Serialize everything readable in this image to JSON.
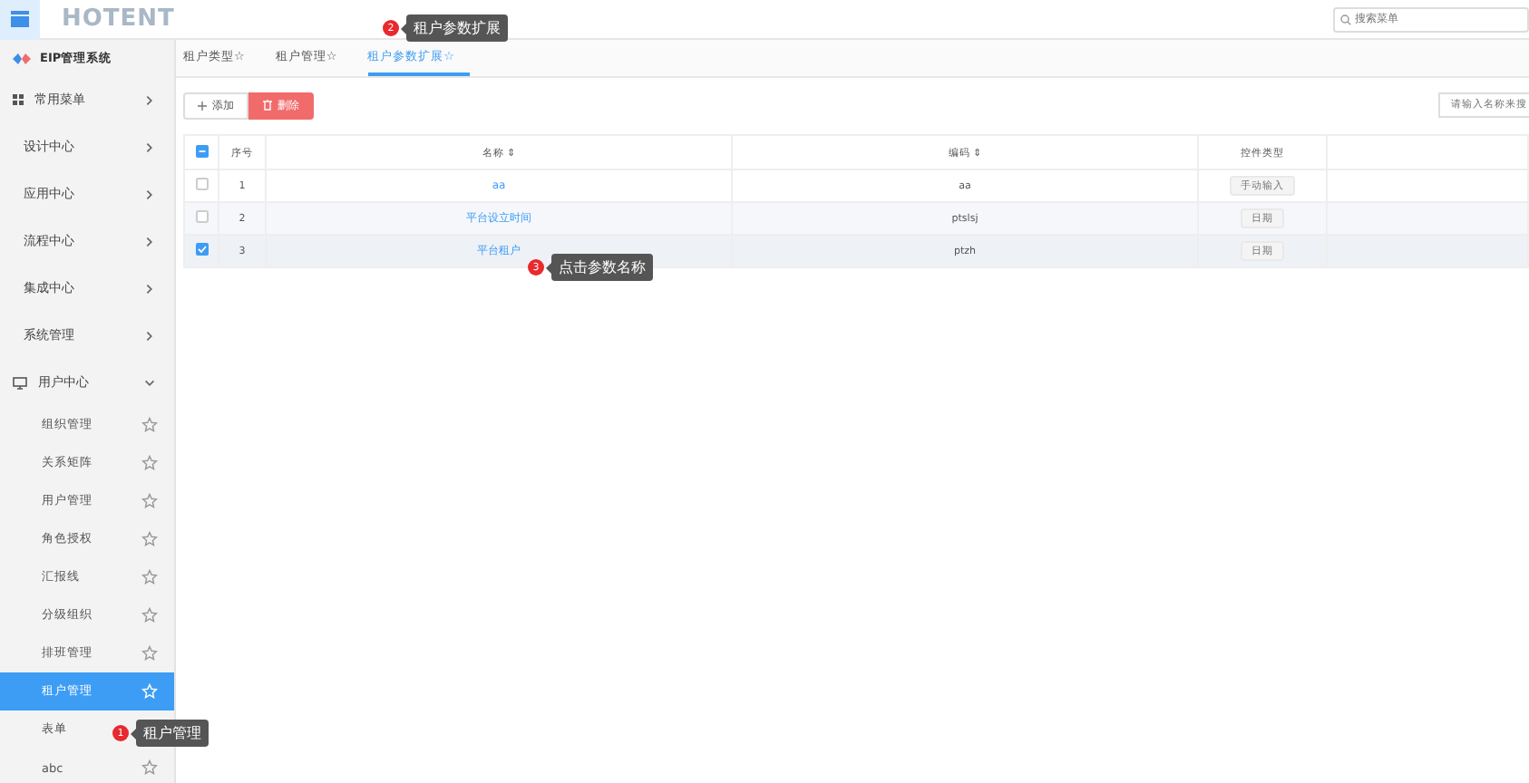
{
  "header": {
    "logo": "HOTENT",
    "search": {
      "placeholder": "搜索菜单"
    }
  },
  "sidebar": {
    "title": "EIP管理系统",
    "items": [
      {
        "label": "常用菜单",
        "kind": "group",
        "expanded": false
      },
      {
        "label": "设计中心",
        "kind": "group",
        "expanded": false
      },
      {
        "label": "应用中心",
        "kind": "group",
        "expanded": false
      },
      {
        "label": "流程中心",
        "kind": "group",
        "expanded": false
      },
      {
        "label": "集成中心",
        "kind": "group",
        "expanded": false
      },
      {
        "label": "系统管理",
        "kind": "group",
        "expanded": false
      },
      {
        "label": "用户中心",
        "kind": "group",
        "expanded": true,
        "children": [
          {
            "label": "组织管理",
            "selected": false,
            "kind": "starred"
          },
          {
            "label": "关系矩阵",
            "selected": false,
            "kind": "starred"
          },
          {
            "label": "用户管理",
            "selected": false,
            "kind": "starred"
          },
          {
            "label": "角色授权",
            "selected": false,
            "kind": "starred"
          },
          {
            "label": "汇报线",
            "selected": false,
            "kind": "starred"
          },
          {
            "label": "分级组织",
            "selected": false,
            "kind": "starred"
          },
          {
            "label": "排班管理",
            "selected": false,
            "kind": "starred"
          },
          {
            "label": "租户管理",
            "selected": true,
            "kind": "starred"
          },
          {
            "label": "表单",
            "selected": false,
            "kind": "plain"
          },
          {
            "label": "abc",
            "selected": false,
            "kind": "starred"
          }
        ]
      }
    ]
  },
  "tabs": [
    {
      "label": "租户类型☆",
      "selected": false
    },
    {
      "label": "租户管理☆",
      "selected": false
    },
    {
      "label": "租户参数扩展☆",
      "selected": true
    }
  ],
  "toolbar": {
    "buttons": [
      {
        "label": "添加",
        "kind": "add"
      },
      {
        "label": "删除",
        "kind": "delete"
      }
    ],
    "search": {
      "placeholder": "请输入名称来搜"
    }
  },
  "table": {
    "header_indeterminate": true,
    "columns": [
      "序号",
      "名称 ⇕",
      "编码 ⇕",
      "控件类型"
    ],
    "rows": [
      {
        "checked": false,
        "index": "1",
        "name": "aa",
        "code": "aa",
        "type": "手动输入"
      },
      {
        "checked": false,
        "index": "2",
        "name": "平台设立时间",
        "code": "ptslsj",
        "type": "日期"
      },
      {
        "checked": true,
        "index": "3",
        "name": "平台租户",
        "code": "ptzh",
        "type": "日期"
      }
    ]
  },
  "tips": [
    {
      "number": "2",
      "text": "租户参数扩展"
    },
    {
      "number": "3",
      "text": "点击参数名称"
    },
    {
      "number": "1",
      "text": "租户管理"
    }
  ]
}
